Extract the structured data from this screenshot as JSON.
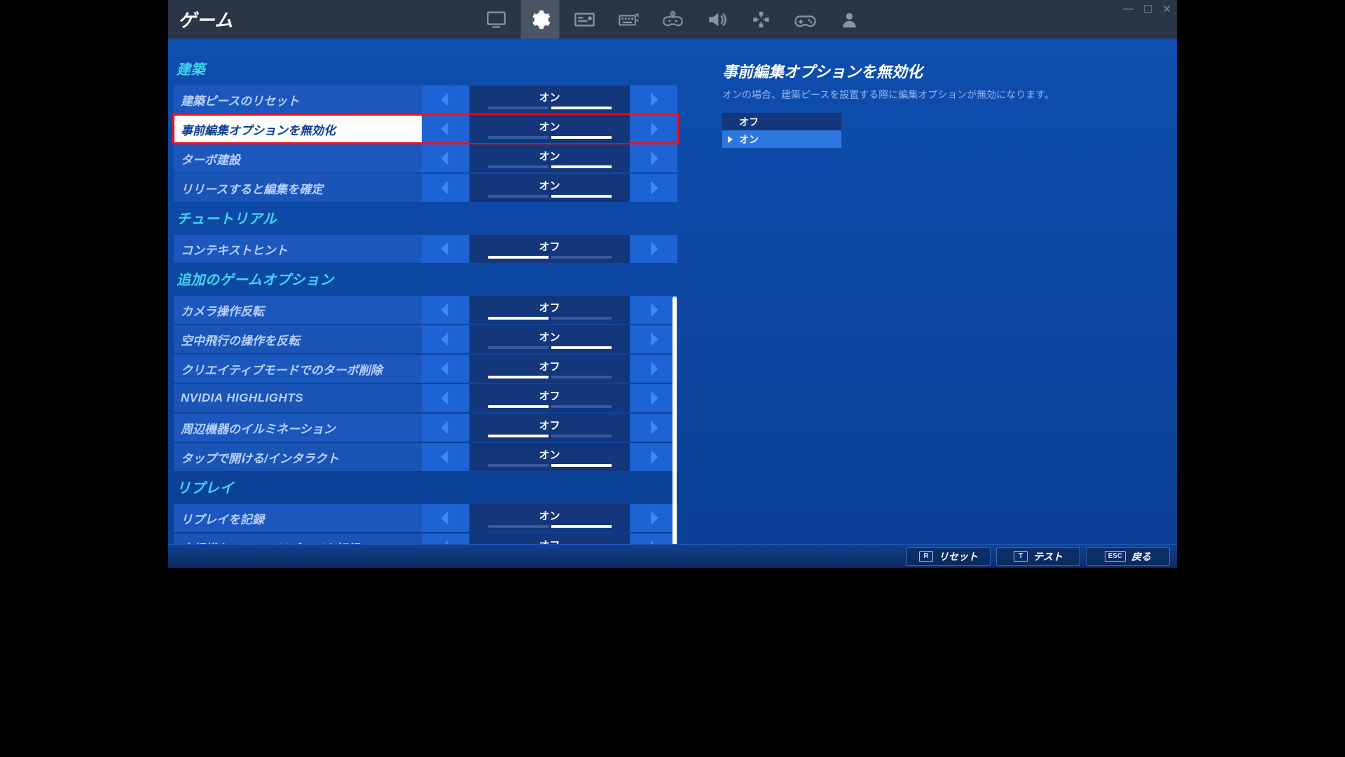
{
  "header": {
    "title": "ゲーム"
  },
  "tabs": [
    "display",
    "settings",
    "name-tags",
    "keyboard",
    "controller-config",
    "audio",
    "accessibility",
    "controller",
    "account"
  ],
  "window_buttons": [
    "—",
    "☐",
    "✕"
  ],
  "sections": [
    {
      "title": "建築",
      "rows": [
        {
          "label": "建築ピースのリセット",
          "value": "オン",
          "on_index": 1,
          "segs": 2,
          "selected": false
        },
        {
          "label": "事前編集オプションを無効化",
          "value": "オン",
          "on_index": 1,
          "segs": 2,
          "selected": true
        },
        {
          "label": "ターボ建設",
          "value": "オン",
          "on_index": 1,
          "segs": 2,
          "selected": false
        },
        {
          "label": "リリースすると編集を確定",
          "value": "オン",
          "on_index": 1,
          "segs": 2,
          "selected": false
        }
      ]
    },
    {
      "title": "チュートリアル",
      "rows": [
        {
          "label": "コンテキストヒント",
          "value": "オフ",
          "on_index": 0,
          "segs": 2,
          "selected": false
        }
      ]
    },
    {
      "title": "追加のゲームオプション",
      "rows": [
        {
          "label": "カメラ操作反転",
          "value": "オフ",
          "on_index": 0,
          "segs": 2,
          "selected": false
        },
        {
          "label": "空中飛行の操作を反転",
          "value": "オン",
          "on_index": 1,
          "segs": 2,
          "selected": false
        },
        {
          "label": "クリエイティブモードでのターボ削除",
          "value": "オフ",
          "on_index": 0,
          "segs": 2,
          "selected": false
        },
        {
          "label": "NVIDIA HIGHLIGHTS",
          "value": "オフ",
          "on_index": 0,
          "segs": 2,
          "selected": false,
          "eng": true
        },
        {
          "label": "周辺機器のイルミネーション",
          "value": "オフ",
          "on_index": 0,
          "segs": 2,
          "selected": false
        },
        {
          "label": "タップで開ける/インタラクト",
          "value": "オン",
          "on_index": 1,
          "segs": 2,
          "selected": false
        }
      ]
    },
    {
      "title": "リプレイ",
      "rows": [
        {
          "label": "リプレイを記録",
          "value": "オン",
          "on_index": 1,
          "segs": 2,
          "selected": false
        },
        {
          "label": "大規模なチームのリプレイを記録",
          "value": "オフ",
          "on_index": 0,
          "segs": 2,
          "selected": false
        }
      ]
    }
  ],
  "description": {
    "title": "事前編集オプションを無効化",
    "body": "オンの場合、建築ピースを設置する際に編集オプションが無効になります。",
    "options": [
      {
        "label": "オフ",
        "selected": false
      },
      {
        "label": "オン",
        "selected": true
      }
    ]
  },
  "footer": {
    "reset": {
      "key": "R",
      "label": "リセット"
    },
    "test": {
      "key": "T",
      "label": "テスト"
    },
    "back": {
      "key": "ESC",
      "label": "戻る"
    }
  }
}
